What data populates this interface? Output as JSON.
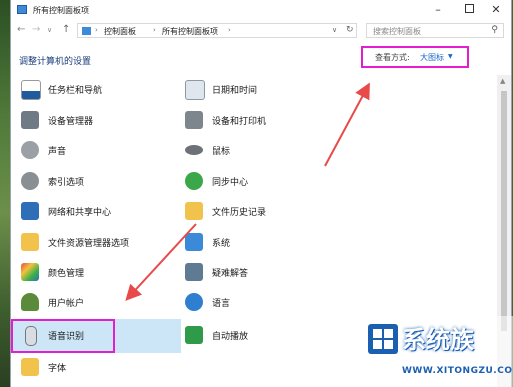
{
  "window": {
    "title": "所有控制面板项"
  },
  "address": {
    "crumbs": [
      "控制面板",
      "所有控制面板项"
    ],
    "search_placeholder": "搜索控制面板"
  },
  "header": {
    "title": "调整计算机的设置",
    "view_by_label": "查看方式:",
    "view_by_value": "大图标"
  },
  "items_left": [
    {
      "label": "任务栏和导航",
      "icon": "taskbar-icon"
    },
    {
      "label": "设备管理器",
      "icon": "device-manager-icon"
    },
    {
      "label": "声音",
      "icon": "sound-icon"
    },
    {
      "label": "索引选项",
      "icon": "indexing-options-icon"
    },
    {
      "label": "网络和共享中心",
      "icon": "network-sharing-icon"
    },
    {
      "label": "文件资源管理器选项",
      "icon": "folder-options-icon"
    },
    {
      "label": "颜色管理",
      "icon": "color-management-icon"
    },
    {
      "label": "用户帐户",
      "icon": "user-accounts-icon"
    },
    {
      "label": "语音识别",
      "icon": "microphone-icon"
    },
    {
      "label": "字体",
      "icon": "fonts-icon"
    }
  ],
  "items_right": [
    {
      "label": "日期和时间",
      "icon": "date-time-icon"
    },
    {
      "label": "设备和打印机",
      "icon": "printer-icon"
    },
    {
      "label": "鼠标",
      "icon": "mouse-icon"
    },
    {
      "label": "同步中心",
      "icon": "sync-center-icon"
    },
    {
      "label": "文件历史记录",
      "icon": "file-history-icon"
    },
    {
      "label": "系统",
      "icon": "system-icon"
    },
    {
      "label": "疑难解答",
      "icon": "troubleshooting-icon"
    },
    {
      "label": "语言",
      "icon": "language-icon"
    },
    {
      "label": "自动播放",
      "icon": "autoplay-icon"
    }
  ],
  "watermark": {
    "text": "系统族",
    "url": "WWW.XITONGZU.COM"
  },
  "colors": {
    "highlight_box": "#e21fd0",
    "arrow": "#e84a4a",
    "link_blue": "#1a66c8"
  }
}
